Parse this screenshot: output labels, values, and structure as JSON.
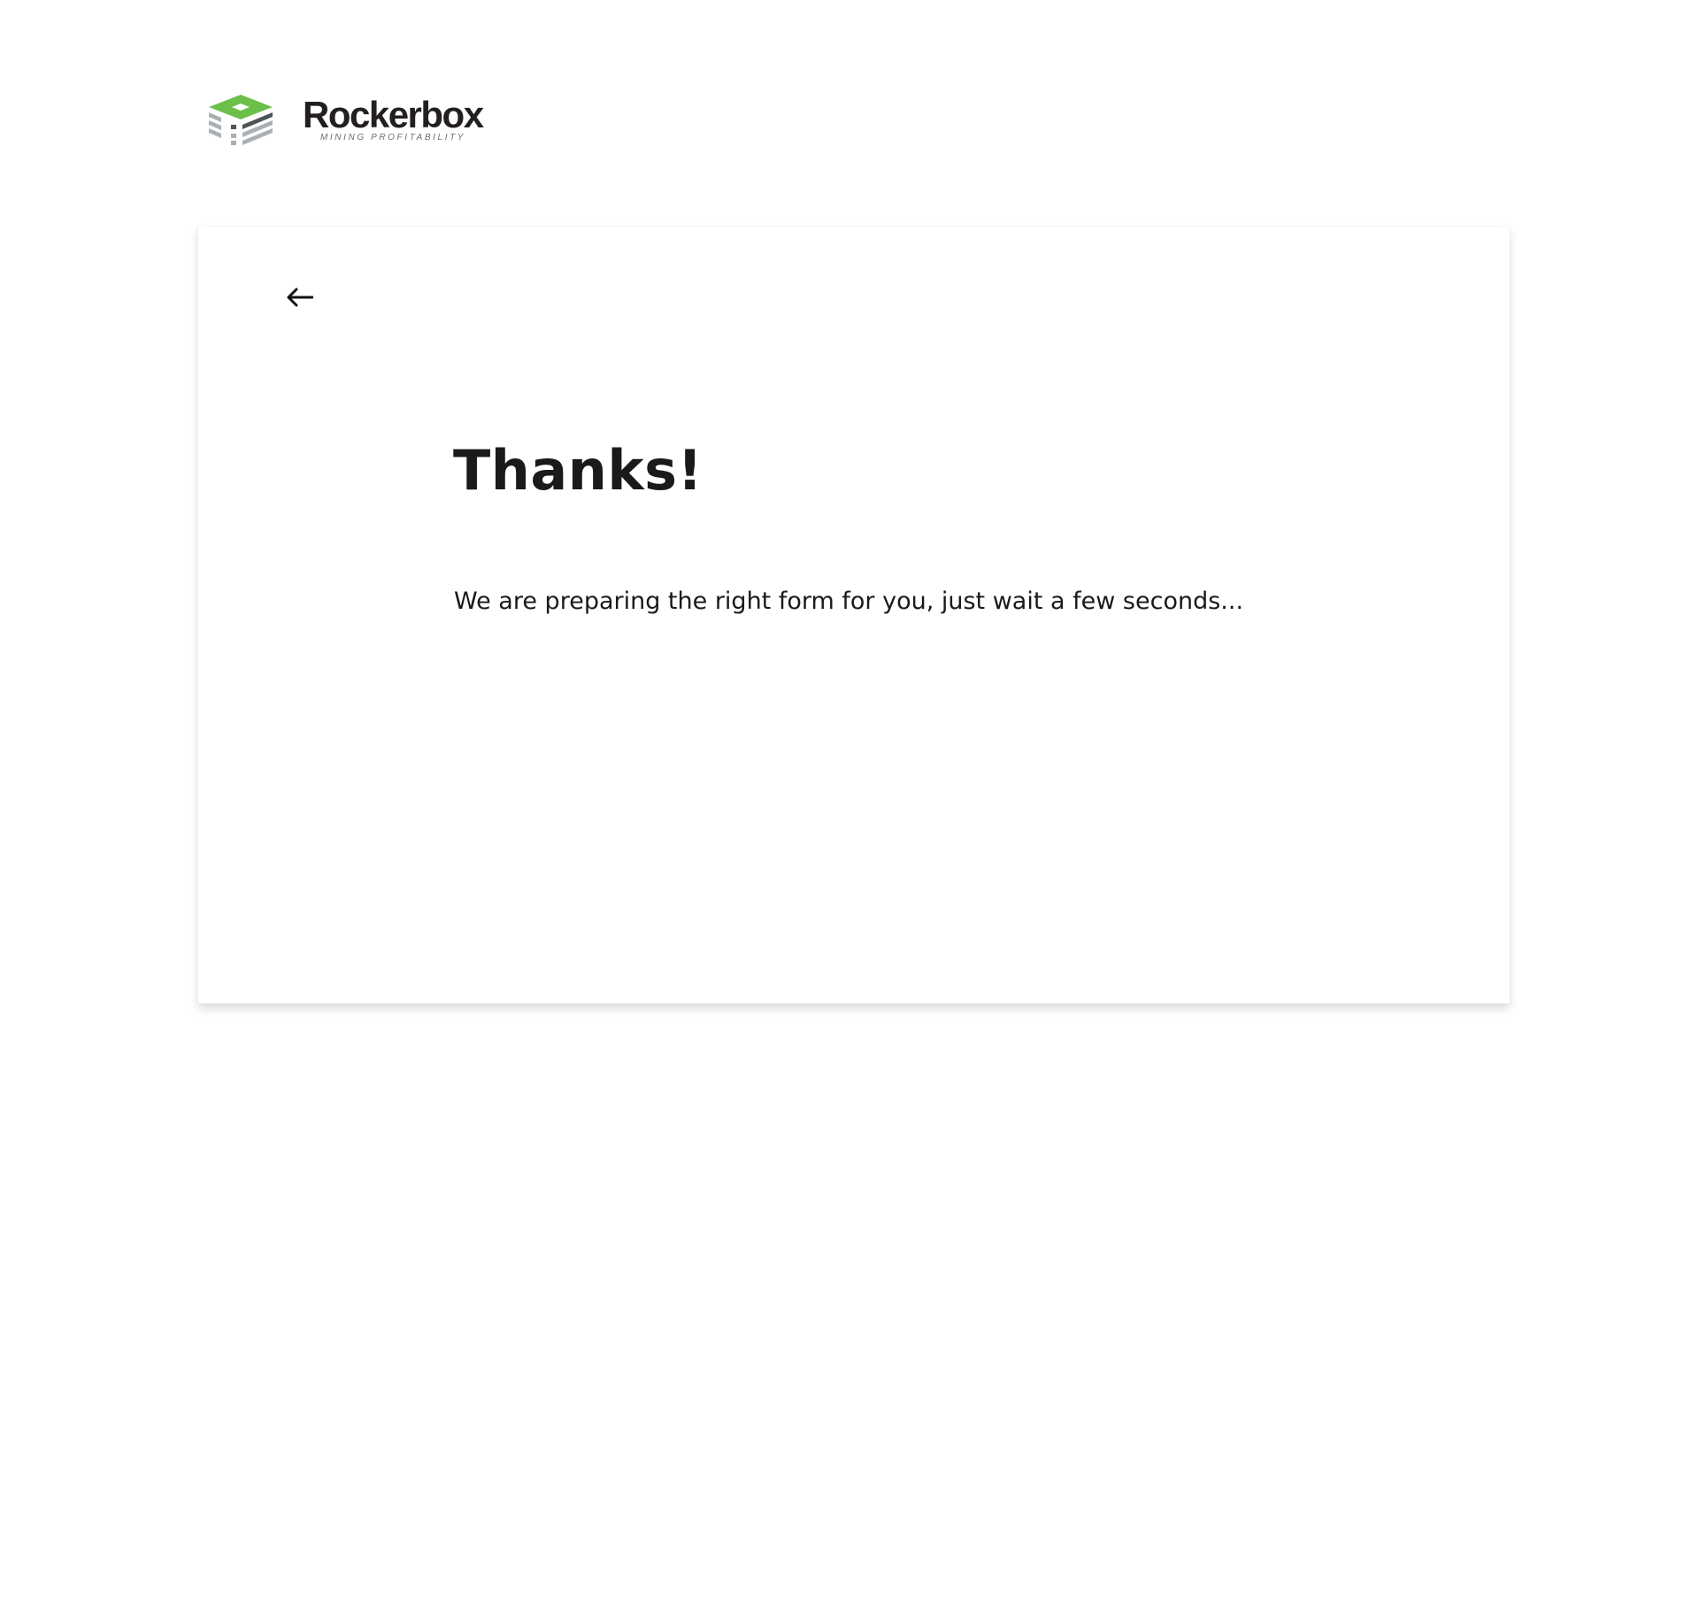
{
  "header": {
    "logo": {
      "name": "Rockerbox",
      "tagline": "MINING PROFITABILITY",
      "icon": "rockerbox-logo-icon",
      "colors": {
        "green": "#6cc04a",
        "gray": "#a7b0b3",
        "dark": "#4d5456",
        "text": "#231f20"
      }
    }
  },
  "card": {
    "back_icon": "arrow-left-icon",
    "title": "Thanks!",
    "message": "We are preparing the right form for you, just wait a few seconds..."
  }
}
